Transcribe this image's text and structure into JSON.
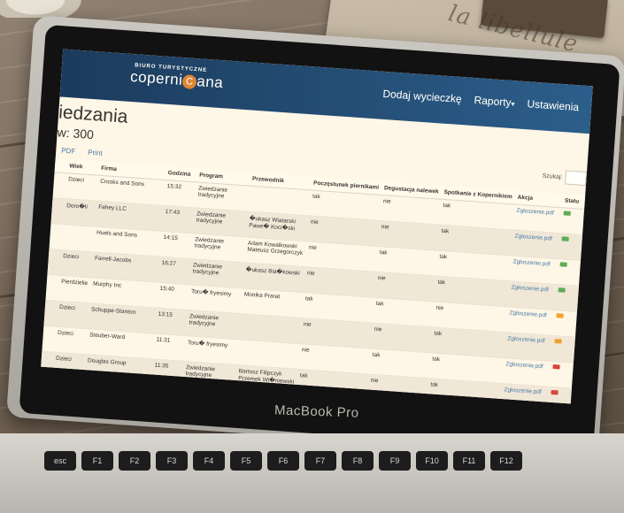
{
  "photo": {
    "journal_text": "la libellule",
    "laptop_brand": "MacBook Pro"
  },
  "navbar": {
    "logo_tagline": "BIURO TURYSTYCZNE",
    "logo_pre": "coperni",
    "logo_o": "C",
    "logo_post": "ana",
    "links": [
      "Dodaj wycieczkę",
      "Raporty",
      "Ustawienia"
    ]
  },
  "page": {
    "title": "iedzania",
    "count": "w: 300",
    "export": [
      "PDF",
      "Print"
    ],
    "search_label": "Szukaj:"
  },
  "table": {
    "headers": [
      "Wiek",
      "Firma",
      "Godzina",
      "Program",
      "Przewodnik",
      "Poczęstunek piernikami",
      "Degustacja nalewek",
      "Spotkanie z Kopernikiem",
      "Akcja",
      "Statu"
    ],
    "action_label": "Zgłoszenie.pdf",
    "rows": [
      [
        "Dzieci",
        "Crooks and Sons",
        "15:32",
        "Zwiedzanie tradycyjne",
        "",
        "tak",
        "nie",
        "tak"
      ],
      [
        "Doro�li",
        "Fahey LLC",
        "17:43",
        "Zwiedzanie tradycyjne",
        "�ukasz Wiatarski Pawe� Koci�ski",
        "nie",
        "nie",
        "tak"
      ],
      [
        "",
        "Huels and Sons",
        "14:15",
        "Zwiedzanie tradycyjne",
        "Adam Kowalkowski Mateusz Grzegorczyk",
        "nie",
        "tak",
        "tak"
      ],
      [
        "Dzieci",
        "Farrell-Jacobs",
        "16:27",
        "Zwiedzanie tradycyjne",
        "�ukasz Bia�kowski",
        "nie",
        "nie",
        "tak"
      ],
      [
        "Pierdzielie",
        "Murphy Inc",
        "15:40",
        "Toru� fryesimy",
        "Monika Prarat",
        "tak",
        "tak",
        "nie"
      ],
      [
        "Dzieci",
        "Schuppe-Stanton",
        "13:15",
        "Zwiedzanie tradycyjne",
        "",
        "nie",
        "nie",
        "tak"
      ],
      [
        "Dzieci",
        "Steuber-Ward",
        "11:31",
        "Toru� fryesimy",
        "",
        "nie",
        "tak",
        "tak"
      ],
      [
        "Dzieci",
        "Douglas Group",
        "11:35",
        "Zwiedzanie tradycyjne",
        "Bartosz Filipczyk Przemek Wi�niewski",
        "tak",
        "nie",
        "tak"
      ]
    ],
    "status_colors": [
      "#4caf50",
      "#4caf50",
      "#4caf50",
      "#4caf50",
      "#f39c12",
      "#f39c12",
      "#e53935",
      "#e53935"
    ]
  },
  "keyboard": [
    "esc",
    "F1",
    "F2",
    "F3",
    "F4",
    "F5",
    "F6",
    "F7",
    "F8",
    "F9",
    "F10",
    "F11",
    "F12"
  ]
}
